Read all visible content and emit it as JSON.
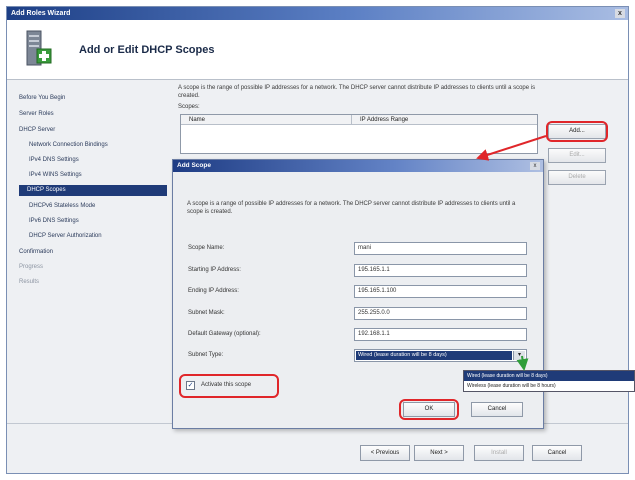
{
  "window": {
    "title": "Add Roles Wizard"
  },
  "header": {
    "title": "Add or Edit DHCP Scopes"
  },
  "nav": {
    "items": [
      {
        "label": "Before You Begin"
      },
      {
        "label": "Server Roles"
      },
      {
        "label": "DHCP Server"
      },
      {
        "label": "Network Connection Bindings"
      },
      {
        "label": "IPv4 DNS Settings"
      },
      {
        "label": "IPv4 WINS Settings"
      },
      {
        "label": "DHCP Scopes"
      },
      {
        "label": "DHCPv6 Stateless Mode"
      },
      {
        "label": "IPv6 DNS Settings"
      },
      {
        "label": "DHCP Server Authorization"
      },
      {
        "label": "Confirmation"
      },
      {
        "label": "Progress"
      },
      {
        "label": "Results"
      }
    ]
  },
  "main": {
    "description": "A scope is the range of possible IP addresses for a network. The DHCP server cannot distribute IP addresses to clients until a scope is created.",
    "scopes_label": "Scopes:",
    "columns": [
      "Name",
      "IP Address Range"
    ],
    "add_label": "Add...",
    "edit_label": "Edit...",
    "delete_label": "Delete"
  },
  "dialog": {
    "title": "Add Scope",
    "description": "A scope is a range of possible IP addresses for a network. The DHCP server cannot distribute IP addresses to clients until a scope is created.",
    "fields": [
      {
        "label": "Scope Name:",
        "value": "mani"
      },
      {
        "label": "Starting IP Address:",
        "value": "195.165.1.1"
      },
      {
        "label": "Ending IP Address:",
        "value": "195.165.1.100"
      },
      {
        "label": "Subnet Mask:",
        "value": "255.255.0.0"
      },
      {
        "label": "Default Gateway (optional):",
        "value": "192.168.1.1"
      }
    ],
    "subnet_type_label": "Subnet Type:",
    "subnet_type_value": "Wired (lease duration will be 8 days)",
    "activate_label": "Activate this scope",
    "ok_label": "OK",
    "cancel_label": "Cancel"
  },
  "dropdown": {
    "options": [
      "Wired (lease duration will be 8 days)",
      "Wireless (lease duration will be 8 hours)"
    ]
  },
  "footer": {
    "previous_label": "< Previous",
    "next_label": "Next >",
    "install_label": "Install",
    "cancel_label": "Cancel"
  },
  "colors": {
    "highlight_ring": "#e0262a",
    "selection": "#1f3b78",
    "arrow_green": "#2f9e3a"
  }
}
